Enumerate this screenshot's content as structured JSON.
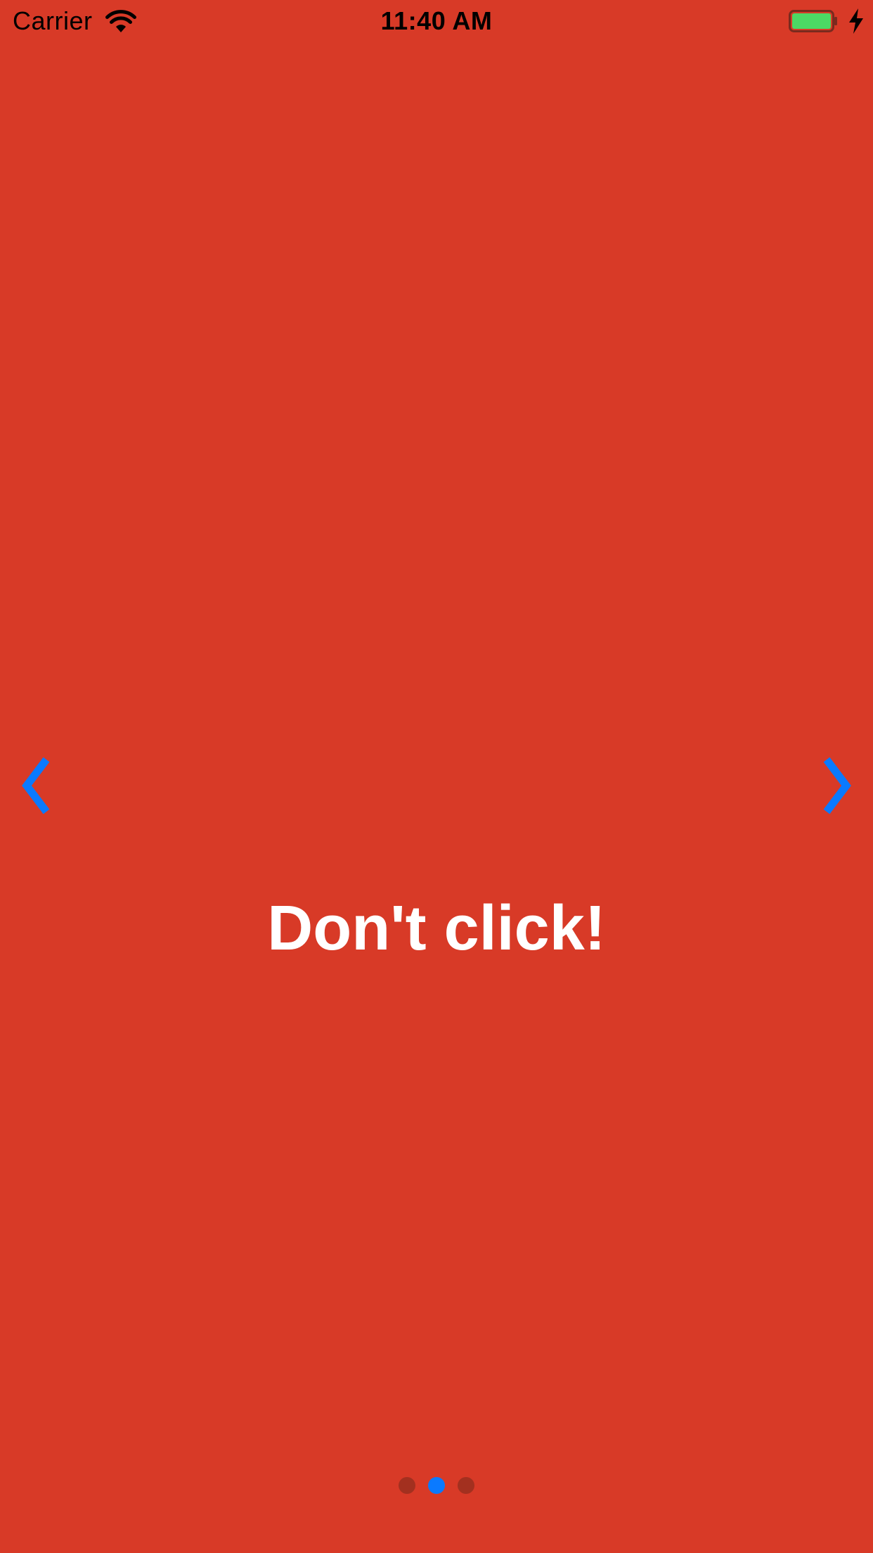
{
  "status_bar": {
    "carrier": "Carrier",
    "time": "11:40 AM",
    "wifi_icon": "wifi-icon",
    "battery_icon": "battery-icon",
    "battery_level": 1.0,
    "charging_icon": "charging-bolt-icon"
  },
  "navigation": {
    "prev_icon": "chevron-left-icon",
    "next_icon": "chevron-right-icon"
  },
  "main": {
    "message": "Don't click!"
  },
  "page_control": {
    "total_pages": 3,
    "current_page": 2
  },
  "colors": {
    "background": "#D83A27",
    "text": "#FFFFFF",
    "accent": "#0A7AFF",
    "dot_inactive": "#A3301F",
    "battery_fill": "#4CD964"
  }
}
